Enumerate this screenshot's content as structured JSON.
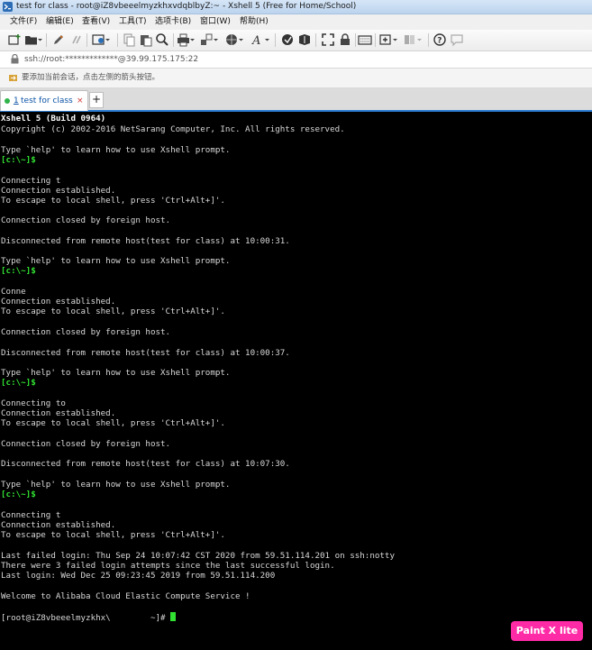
{
  "window": {
    "title": "test for class - root@iZ8vbeeelmyzkhxvdqblbyZ:~ - Xshell 5 (Free for Home/School)"
  },
  "menu": {
    "items": [
      "文件(F)",
      "编辑(E)",
      "查看(V)",
      "工具(T)",
      "选项卡(B)",
      "窗口(W)",
      "帮助(H)"
    ]
  },
  "address": {
    "text": "ssh://root:*************@39.99.175.175:22"
  },
  "hint": {
    "text": "要添加当前会话，点击左侧的箭头按钮。"
  },
  "tabs": [
    {
      "number": "1",
      "label": "test for class",
      "close": "×",
      "status_color": "#2fb34a"
    }
  ],
  "tab_add": "+",
  "terminal": {
    "header": "Xshell 5 (Build 0964)",
    "lines": [
      "Copyright (c) 2002-2016 NetSarang Computer, Inc. All rights reserved.",
      "Type `help' to learn how to use Xshell prompt.",
      "[c:\\~]$",
      "Connecting t",
      "Connection established.",
      "To escape to local shell, press 'Ctrl+Alt+]'.",
      "Connection closed by foreign host.",
      "Disconnected from remote host(test for class) at 10:00:31.",
      "Type `help' to learn how to use Xshell prompt.",
      "[c:\\~]$",
      "Conne",
      "Connection established.",
      "To escape to local shell, press 'Ctrl+Alt+]'.",
      "Connection closed by foreign host.",
      "Disconnected from remote host(test for class) at 10:00:37.",
      "Type `help' to learn how to use Xshell prompt.",
      "[c:\\~]$",
      "Connecting to",
      "Connection established.",
      "To escape to local shell, press 'Ctrl+Alt+]'.",
      "Connection closed by foreign host.",
      "Disconnected from remote host(test for class) at 10:07:30.",
      "Type `help' to learn how to use Xshell prompt.",
      "[c:\\~]$",
      "Connecting t",
      "Connection established.",
      "To escape to local shell, press 'Ctrl+Alt+]'.",
      "Last failed login: Thu Sep 24 10:07:42 CST 2020 from 59.51.114.201 on ssh:notty",
      "There were 3 failed login attempts since the last successful login.",
      "Last login: Wed Dec 25 09:23:45 2019 from 59.51.114.200",
      "Welcome to Alibaba Cloud Elastic Compute Service !",
      "[root@iZ8vbeeelmyzkhx\\        ~]# "
    ]
  },
  "watermark": {
    "text": "Paint X lite"
  },
  "colors": {
    "accent": "#2c7cd3",
    "prompt": "#32e032",
    "watermark": "#ff2aa6"
  }
}
